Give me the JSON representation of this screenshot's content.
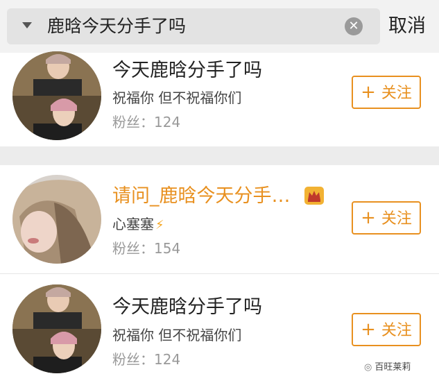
{
  "search": {
    "query": "鹿晗今天分手了吗",
    "clear_icon": "clear-icon",
    "cancel_label": "取消"
  },
  "results": [
    {
      "name": "今天鹿晗分手了吗",
      "description": "祝福你 但不祝福你们",
      "fans_label": "粉丝：",
      "fans_count": "124",
      "follow_label": "关注",
      "name_color": "#222222"
    },
    {
      "name": "请问_鹿晗今天分手…",
      "description": "心塞塞",
      "fans_label": "粉丝：",
      "fans_count": "154",
      "follow_label": "关注",
      "name_color": "#e8901f",
      "badge": "crown-icon",
      "desc_icon": "lightning-icon"
    },
    {
      "name": "今天鹿晗分手了吗",
      "description": "祝福你 但不祝福你们",
      "fans_label": "粉丝：",
      "fans_count": "124",
      "follow_label": "关注",
      "name_color": "#222222"
    }
  ],
  "watermark": {
    "text": "百旺莱莉"
  },
  "colors": {
    "accent": "#e8901f",
    "background": "#f2f2f2",
    "divider": "#ececec"
  }
}
